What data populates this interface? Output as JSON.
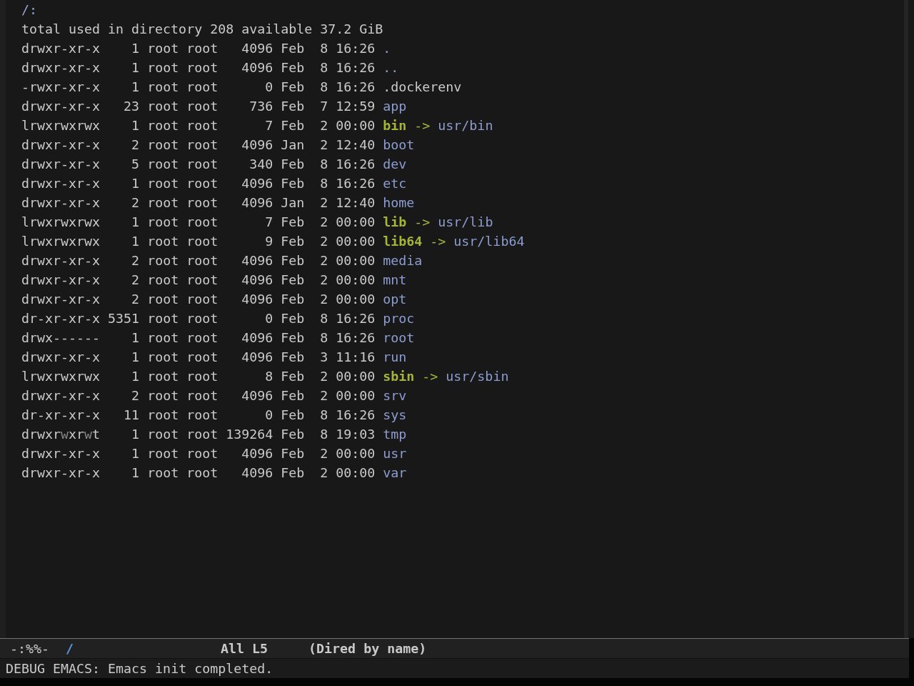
{
  "header": {
    "path": "/:"
  },
  "summary": "total used in directory 208 available 37.2 GiB",
  "entries": [
    {
      "kind": "directory",
      "permissions": [
        {
          "text": "drwxr-xr-x",
          "flagged": false
        }
      ],
      "links": "1",
      "owner": "root",
      "group": "root",
      "size": "4096",
      "month": "Feb",
      "day": "8",
      "time": "16:26",
      "name": "."
    },
    {
      "kind": "directory",
      "permissions": [
        {
          "text": "drwxr-xr-x",
          "flagged": false
        }
      ],
      "links": "1",
      "owner": "root",
      "group": "root",
      "size": "4096",
      "month": "Feb",
      "day": "8",
      "time": "16:26",
      "name": ".."
    },
    {
      "kind": "file",
      "permissions": [
        {
          "text": "-rwxr-xr-x",
          "flagged": false
        }
      ],
      "links": "1",
      "owner": "root",
      "group": "root",
      "size": "0",
      "month": "Feb",
      "day": "8",
      "time": "16:26",
      "name": ".dockerenv"
    },
    {
      "kind": "directory",
      "permissions": [
        {
          "text": "drwxr-xr-x",
          "flagged": false
        }
      ],
      "links": "23",
      "owner": "root",
      "group": "root",
      "size": "736",
      "month": "Feb",
      "day": "7",
      "time": "12:59",
      "name": "app"
    },
    {
      "kind": "symlink",
      "permissions": [
        {
          "text": "lrwxrwxrwx",
          "flagged": false
        }
      ],
      "links": "1",
      "owner": "root",
      "group": "root",
      "size": "7",
      "month": "Feb",
      "day": "2",
      "time": "00:00",
      "name": "bin",
      "arrow": "->",
      "target": "usr/bin"
    },
    {
      "kind": "directory",
      "permissions": [
        {
          "text": "drwxr-xr-x",
          "flagged": false
        }
      ],
      "links": "2",
      "owner": "root",
      "group": "root",
      "size": "4096",
      "month": "Jan",
      "day": "2",
      "time": "12:40",
      "name": "boot"
    },
    {
      "kind": "directory",
      "permissions": [
        {
          "text": "drwxr-xr-x",
          "flagged": false
        }
      ],
      "links": "5",
      "owner": "root",
      "group": "root",
      "size": "340",
      "month": "Feb",
      "day": "8",
      "time": "16:26",
      "name": "dev"
    },
    {
      "kind": "directory",
      "permissions": [
        {
          "text": "drwxr-xr-x",
          "flagged": false
        }
      ],
      "links": "1",
      "owner": "root",
      "group": "root",
      "size": "4096",
      "month": "Feb",
      "day": "8",
      "time": "16:26",
      "name": "etc"
    },
    {
      "kind": "directory",
      "permissions": [
        {
          "text": "drwxr-xr-x",
          "flagged": false
        }
      ],
      "links": "2",
      "owner": "root",
      "group": "root",
      "size": "4096",
      "month": "Jan",
      "day": "2",
      "time": "12:40",
      "name": "home"
    },
    {
      "kind": "symlink",
      "permissions": [
        {
          "text": "lrwxrwxrwx",
          "flagged": false
        }
      ],
      "links": "1",
      "owner": "root",
      "group": "root",
      "size": "7",
      "month": "Feb",
      "day": "2",
      "time": "00:00",
      "name": "lib",
      "arrow": "->",
      "target": "usr/lib"
    },
    {
      "kind": "symlink",
      "permissions": [
        {
          "text": "lrwxrwxrwx",
          "flagged": false
        }
      ],
      "links": "1",
      "owner": "root",
      "group": "root",
      "size": "9",
      "month": "Feb",
      "day": "2",
      "time": "00:00",
      "name": "lib64",
      "arrow": "->",
      "target": "usr/lib64"
    },
    {
      "kind": "directory",
      "permissions": [
        {
          "text": "drwxr-xr-x",
          "flagged": false
        }
      ],
      "links": "2",
      "owner": "root",
      "group": "root",
      "size": "4096",
      "month": "Feb",
      "day": "2",
      "time": "00:00",
      "name": "media"
    },
    {
      "kind": "directory",
      "permissions": [
        {
          "text": "drwxr-xr-x",
          "flagged": false
        }
      ],
      "links": "2",
      "owner": "root",
      "group": "root",
      "size": "4096",
      "month": "Feb",
      "day": "2",
      "time": "00:00",
      "name": "mnt"
    },
    {
      "kind": "directory",
      "permissions": [
        {
          "text": "drwxr-xr-x",
          "flagged": false
        }
      ],
      "links": "2",
      "owner": "root",
      "group": "root",
      "size": "4096",
      "month": "Feb",
      "day": "2",
      "time": "00:00",
      "name": "opt"
    },
    {
      "kind": "directory",
      "permissions": [
        {
          "text": "dr-xr-xr-x",
          "flagged": false
        }
      ],
      "links": "5351",
      "owner": "root",
      "group": "root",
      "size": "0",
      "month": "Feb",
      "day": "8",
      "time": "16:26",
      "name": "proc"
    },
    {
      "kind": "directory",
      "permissions": [
        {
          "text": "drwx------",
          "flagged": false
        }
      ],
      "links": "1",
      "owner": "root",
      "group": "root",
      "size": "4096",
      "month": "Feb",
      "day": "8",
      "time": "16:26",
      "name": "root"
    },
    {
      "kind": "directory",
      "permissions": [
        {
          "text": "drwxr-xr-x",
          "flagged": false
        }
      ],
      "links": "1",
      "owner": "root",
      "group": "root",
      "size": "4096",
      "month": "Feb",
      "day": "3",
      "time": "11:16",
      "name": "run"
    },
    {
      "kind": "symlink",
      "permissions": [
        {
          "text": "lrwxrwxrwx",
          "flagged": false
        }
      ],
      "links": "1",
      "owner": "root",
      "group": "root",
      "size": "8",
      "month": "Feb",
      "day": "2",
      "time": "00:00",
      "name": "sbin",
      "arrow": "->",
      "target": "usr/sbin"
    },
    {
      "kind": "directory",
      "permissions": [
        {
          "text": "drwxr-xr-x",
          "flagged": false
        }
      ],
      "links": "2",
      "owner": "root",
      "group": "root",
      "size": "4096",
      "month": "Feb",
      "day": "2",
      "time": "00:00",
      "name": "srv"
    },
    {
      "kind": "directory",
      "permissions": [
        {
          "text": "dr-xr-xr-x",
          "flagged": false
        }
      ],
      "links": "11",
      "owner": "root",
      "group": "root",
      "size": "0",
      "month": "Feb",
      "day": "8",
      "time": "16:26",
      "name": "sys"
    },
    {
      "kind": "directory",
      "permissions": [
        {
          "text": "drwxr",
          "flagged": false
        },
        {
          "text": "w",
          "flagged": true
        },
        {
          "text": "xr",
          "flagged": false
        },
        {
          "text": "w",
          "flagged": true
        },
        {
          "text": "t",
          "flagged": false
        }
      ],
      "links": "1",
      "owner": "root",
      "group": "root",
      "size": "139264",
      "month": "Feb",
      "day": "8",
      "time": "19:03",
      "name": "tmp"
    },
    {
      "kind": "directory",
      "permissions": [
        {
          "text": "drwxr-xr-x",
          "flagged": false
        }
      ],
      "links": "1",
      "owner": "root",
      "group": "root",
      "size": "4096",
      "month": "Feb",
      "day": "2",
      "time": "00:00",
      "name": "usr"
    },
    {
      "kind": "directory",
      "permissions": [
        {
          "text": "drwxr-xr-x",
          "flagged": false
        }
      ],
      "links": "1",
      "owner": "root",
      "group": "root",
      "size": "4096",
      "month": "Feb",
      "day": "2",
      "time": "00:00",
      "name": "var"
    }
  ],
  "mode_line": {
    "status": "-:%%-",
    "buffer_name": "/",
    "position": "All L5",
    "mode": "(Dired by name)"
  },
  "echo_area": {
    "message": "DEBUG EMACS: Emacs init completed."
  }
}
